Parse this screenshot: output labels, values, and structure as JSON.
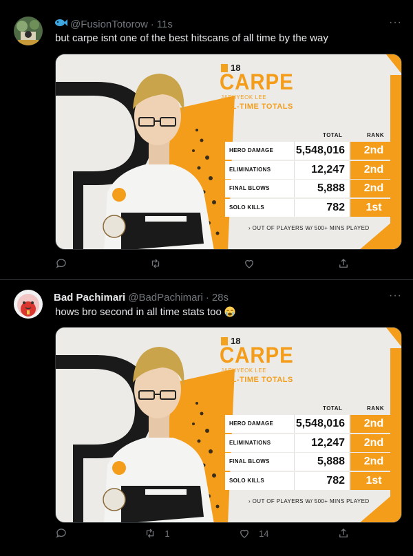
{
  "tweets": [
    {
      "display_name": "",
      "handle": "@FusionTotorow",
      "time": "11s",
      "text": "but carpe isnt one of the best hitscans of all time by the way",
      "reply_count": "",
      "retweet_count": "",
      "like_count": "",
      "card": {
        "number": "18",
        "name": "CARPE",
        "full_name": "JAEHYEOK LEE",
        "heading": "ALL-TIME TOTALS",
        "columns": [
          "TOTAL",
          "RANK"
        ],
        "rows": [
          {
            "label": "HERO DAMAGE",
            "total": "5,548,016",
            "rank": "2nd"
          },
          {
            "label": "ELIMINATIONS",
            "total": "12,247",
            "rank": "2nd"
          },
          {
            "label": "FINAL BLOWS",
            "total": "5,888",
            "rank": "2nd"
          },
          {
            "label": "SOLO KILLS",
            "total": "782",
            "rank": "1st"
          }
        ],
        "footnote": "› OUT OF PLAYERS W/ 500+ MINS PLAYED"
      }
    },
    {
      "display_name": "Bad Pachimari",
      "handle": "@BadPachimari",
      "time": "28s",
      "text": "hows bro second in all time stats too",
      "reply_count": "",
      "retweet_count": "1",
      "like_count": "14",
      "card": {
        "number": "18",
        "name": "CARPE",
        "full_name": "JAEHYEOK LEE",
        "heading": "ALL-TIME TOTALS",
        "columns": [
          "TOTAL",
          "RANK"
        ],
        "rows": [
          {
            "label": "HERO DAMAGE",
            "total": "5,548,016",
            "rank": "2nd"
          },
          {
            "label": "ELIMINATIONS",
            "total": "12,247",
            "rank": "2nd"
          },
          {
            "label": "FINAL BLOWS",
            "total": "5,888",
            "rank": "2nd"
          },
          {
            "label": "SOLO KILLS",
            "total": "782",
            "rank": "1st"
          }
        ],
        "footnote": "› OUT OF PLAYERS W/ 500+ MINS PLAYED"
      }
    }
  ],
  "colors": {
    "accent": "#f39d1b",
    "muted": "#71767b",
    "divider": "#2f3336"
  },
  "icons": [
    "fish-emoji-icon",
    "more-icon",
    "reply-icon",
    "retweet-icon",
    "like-icon",
    "share-icon",
    "crying-emoji-icon"
  ]
}
